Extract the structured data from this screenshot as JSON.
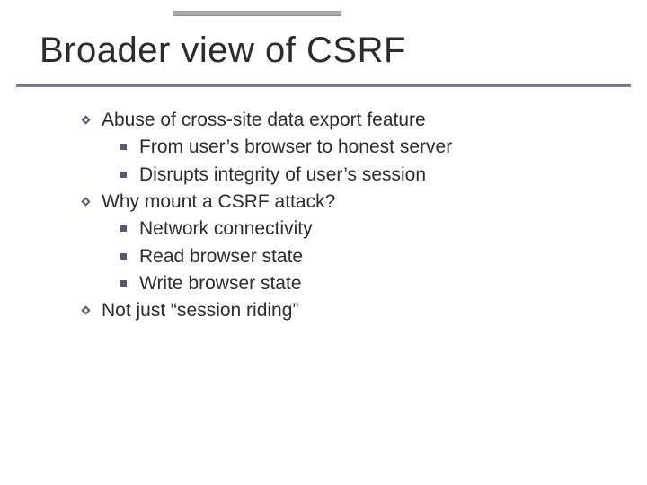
{
  "title": "Broader view of CSRF",
  "bullets": {
    "b1": "Abuse of cross-site data export feature",
    "b1a": "From user’s browser to honest server",
    "b1b": "Disrupts integrity of user’s session",
    "b2": "Why mount a CSRF attack?",
    "b2a": "Network connectivity",
    "b2b": "Read browser state",
    "b2c": "Write browser state",
    "b3": "Not just “session riding”"
  }
}
